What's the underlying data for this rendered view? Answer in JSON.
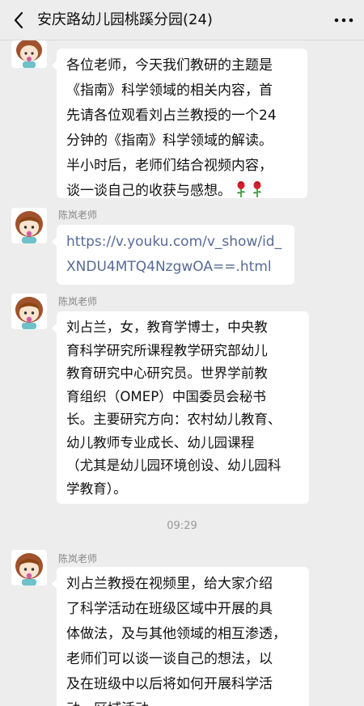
{
  "header": {
    "title": "安庆路幼儿园桃蹊分园(24)",
    "back_icon": "chevron-left-icon",
    "more_icon": "more-dots-icon"
  },
  "messages": [
    {
      "sender": "",
      "lines": [
        "各位老师，今天我们教研的主题是",
        "《指南》科学领域的相关内容，首",
        "先请各位观看刘占兰教授的一个24",
        "分钟的《指南》科学领域的解读。",
        "半小时后，老师们结合视频内容，",
        "谈一谈自己的收获与感想。"
      ],
      "emoji": "rose-icon rose-icon"
    },
    {
      "sender": "陈岚老师",
      "lines": [
        "https://v.youku.com/v_show/id_",
        "XNDU4MTQ4NzgwOA==.html"
      ]
    },
    {
      "sender": "陈岚老师",
      "lines": [
        "刘占兰，女，教育学博士，中央教",
        "育科学研究所课程教学研究部幼儿",
        "教育研究中心研究员。世界学前教",
        "育组织（OMEP）中国委员会秘书",
        "长。主要研究方向：农村幼儿教育、",
        "幼儿教师专业成长、幼儿园课程",
        "（尤其是幼儿园环境创设、幼儿园科",
        "学教育）。"
      ]
    },
    {
      "timestamp": "09:29"
    },
    {
      "sender": "陈岚老师",
      "lines": [
        "刘占兰教授在视频里，给大家介绍",
        "了科学活动在班级区域中开展的具",
        "体做法，及与其他领域的相互渗透，",
        "老师们可以谈一谈自己的想法，以",
        "及在班级中以后将如何开展科学活",
        "动，区域活动。"
      ]
    }
  ]
}
